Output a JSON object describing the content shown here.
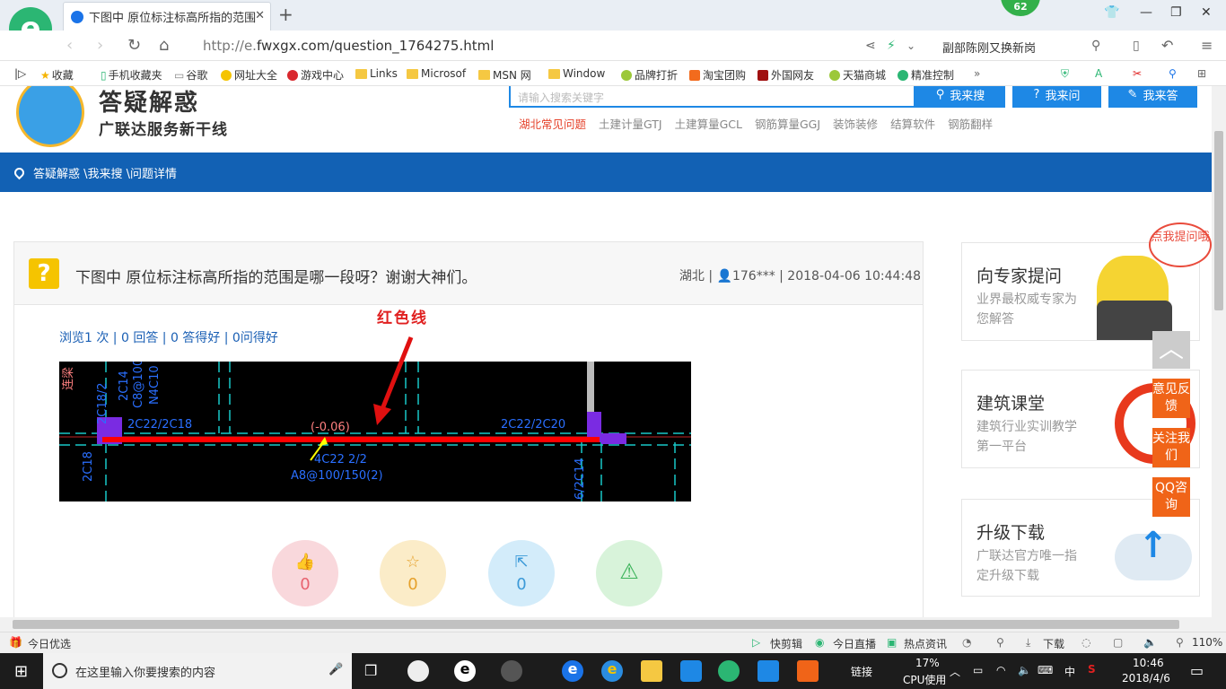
{
  "browser": {
    "tab_title": "下图中 原位标注标高所指的范围",
    "close_glyph": "✕",
    "new_tab_glyph": "+",
    "badge_count": "62",
    "url_prefix": "http://e.",
    "url_rest": "fwxgx.com/question_1764275.html",
    "recommend_text": "副部陈刚又换新岗",
    "bookmarks": [
      {
        "label": "收藏",
        "kind": "star"
      },
      {
        "label": "手机收藏夹",
        "kind": "phone"
      },
      {
        "label": "谷歌",
        "kind": "page"
      },
      {
        "label": "网址大全",
        "kind": "circle-yellow"
      },
      {
        "label": "游戏中心",
        "kind": "circle-red"
      },
      {
        "label": "Links",
        "kind": "folder"
      },
      {
        "label": "Microsof",
        "kind": "folder"
      },
      {
        "label": "MSN 网",
        "kind": "folder"
      },
      {
        "label": "Window",
        "kind": "folder"
      },
      {
        "label": "品牌打折",
        "kind": "leaf"
      },
      {
        "label": "淘宝团购",
        "kind": "circle-orange"
      },
      {
        "label": "外国网友",
        "kind": "circle-darkred"
      },
      {
        "label": "天猫商城",
        "kind": "leaf"
      },
      {
        "label": "精准控制",
        "kind": "circle-green"
      }
    ],
    "more_glyph": "»"
  },
  "site": {
    "title": "答疑解惑",
    "subtitle": "广联达服务新干线",
    "search_placeholder": "请输入搜索关键字",
    "btn_search": "我来搜",
    "btn_ask": "我来问",
    "btn_answer": "我来答",
    "quick_links": [
      "湖北常见问题",
      "土建计量GTJ",
      "土建算量GCL",
      "钢筋算量GGJ",
      "装饰装修",
      "结算软件",
      "钢筋翻样"
    ],
    "breadcrumb": "答疑解惑 \\我来搜 \\问题详情"
  },
  "question": {
    "title": "下图中 原位标注标高所指的范围是哪一段呀？谢谢大神们。",
    "meta": "湖北 | 👤176*** | 2018-04-06 10:44:48",
    "stats": "浏览1 次 | 0 回答 | 0 答得好 | 0问得好",
    "annotation": "红色线",
    "cad_labels": {
      "left_vertical": "2C18/2",
      "beam_left": "2C22/2C18",
      "beam_right": "2C22/2C20",
      "elevation": "(-0.06)",
      "rebar_main": "4C22 2/2",
      "stirrup": "A8@100/150(2)",
      "col_top_a": "2C14",
      "col_top_b": "C8@100",
      "col_top_c": "N4C10",
      "left_bottom": "2C18",
      "right_bottom": "6/2C14",
      "tie_beam": "连梁"
    },
    "actions": [
      {
        "icon": "thumb-up-icon",
        "count": "0",
        "color": "#f9d8dc",
        "fg": "#e8626f"
      },
      {
        "icon": "star-icon",
        "count": "0",
        "color": "#fbecc8",
        "fg": "#e6a12b"
      },
      {
        "icon": "share-icon",
        "count": "0",
        "color": "#d3ecfa",
        "fg": "#3c9ad8"
      },
      {
        "icon": "warning-icon",
        "count": "",
        "color": "#d8f3da",
        "fg": "#3cb35a"
      }
    ]
  },
  "sidebar": {
    "expert_title": "向专家提问",
    "expert_desc": "业界最权威专家为您解答",
    "expert_bubble": "点我提问哦",
    "course_title": "建筑课堂",
    "course_desc": "建筑行业实训教学第一平台",
    "upgrade_title": "升级下载",
    "upgrade_desc": "广联达官方唯一指定升级下载",
    "back_to_top": "︿",
    "feedback": "意见反馈",
    "follow": "关注我们",
    "qq": "QQ咨询"
  },
  "statusbar": {
    "left": "今日优选",
    "items": [
      "快剪辑",
      "今日直播",
      "热点资讯",
      "下载"
    ],
    "zoom": "110%"
  },
  "taskbar": {
    "search_placeholder": "在这里输入你要搜索的内容",
    "link_label": "链接",
    "cpu_percent": "17%",
    "cpu_label": "CPU使用",
    "ime": "中",
    "time": "10:46",
    "date": "2018/4/6"
  }
}
